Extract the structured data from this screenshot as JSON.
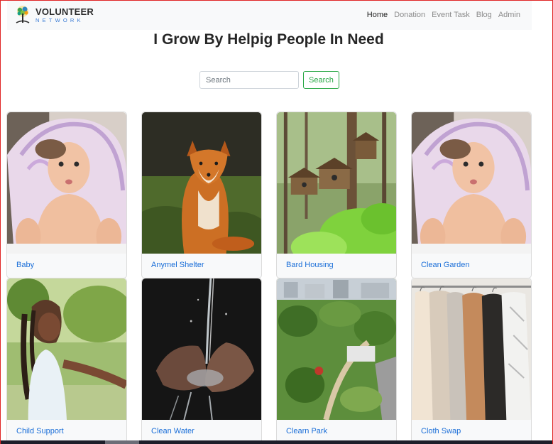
{
  "navbar": {
    "brand_main": "VOLUNTEER",
    "brand_sub": "NETWORK",
    "links": [
      {
        "label": "Home"
      },
      {
        "label": "Donation"
      },
      {
        "label": "Event Task"
      },
      {
        "label": "Blog"
      },
      {
        "label": "Admin"
      }
    ]
  },
  "header": {
    "title": "I Grow By Helpig People In Need"
  },
  "search": {
    "placeholder": "Search",
    "button_label": "Search"
  },
  "cards": [
    {
      "label": "Baby",
      "image": "baby-photo"
    },
    {
      "label": "Anymel Shelter",
      "image": "fox-photo"
    },
    {
      "label": "Bard Housing",
      "image": "birdhouse-photo"
    },
    {
      "label": "Clean Garden",
      "image": "baby-photo"
    },
    {
      "label": "Child Support",
      "image": "girl-photo"
    },
    {
      "label": "Clean Water",
      "image": "water-hands-photo"
    },
    {
      "label": "Clearn Park",
      "image": "park-photo"
    },
    {
      "label": "Cloth Swap",
      "image": "clothes-photo"
    }
  ],
  "colors": {
    "accent": "#28a745",
    "link": "#1a6ed8",
    "frame": "#e02424"
  }
}
